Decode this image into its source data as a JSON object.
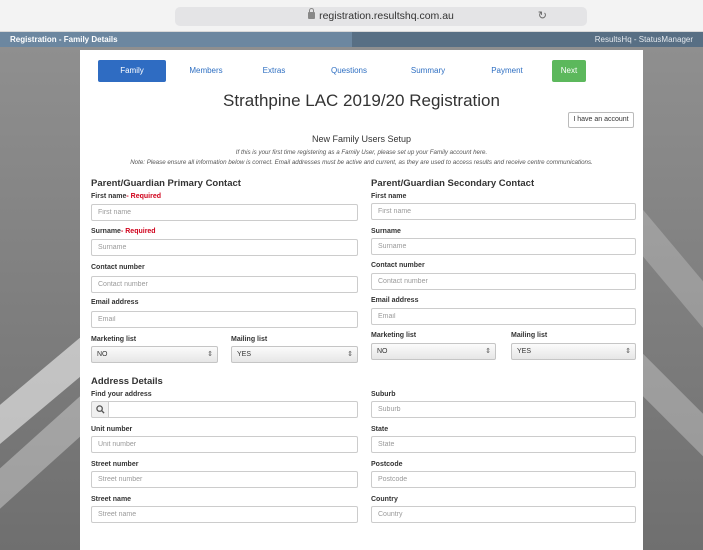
{
  "browser": {
    "url": "registration.resultshq.com.au",
    "tabs": [
      "Registration - Family Details",
      "ResultsHq - StatusManager"
    ]
  },
  "steps": [
    "Family",
    "Members",
    "Extras",
    "Questions",
    "Summary",
    "Payment",
    "Next"
  ],
  "page": {
    "title": "Strathpine LAC 2019/20 Registration",
    "account_button": "I have an account",
    "setup_title": "New Family Users Setup",
    "info_line_1": "If this is your first time registering as a Family User, please set up your Family account here.",
    "info_line_2": "Note: Please ensure all information below is correct. Email addresses must be active and current, as they are used to access results and receive centre communications."
  },
  "primary": {
    "heading": "Parent/Guardian Primary Contact",
    "first_name_label": "First name",
    "required_suffix": "- Required",
    "first_name_placeholder": "First name",
    "surname_label": "Surname",
    "surname_placeholder": "Surname",
    "contact_label": "Contact number",
    "contact_placeholder": "Contact number",
    "email_label": "Email address",
    "email_placeholder": "Email",
    "marketing_label": "Marketing list",
    "marketing_value": "NO",
    "mailing_label": "Mailing list",
    "mailing_value": "YES"
  },
  "secondary": {
    "heading": "Parent/Guardian Secondary Contact",
    "first_name_label": "First name",
    "first_name_placeholder": "First name",
    "surname_label": "Surname",
    "surname_placeholder": "Surname",
    "contact_label": "Contact number",
    "contact_placeholder": "Contact number",
    "email_label": "Email address",
    "email_placeholder": "Email",
    "marketing_label": "Marketing list",
    "marketing_value": "NO",
    "mailing_label": "Mailing list",
    "mailing_value": "YES"
  },
  "address": {
    "heading": "Address Details",
    "find_label": "Find your address",
    "unit_label": "Unit number",
    "unit_placeholder": "Unit number",
    "street_number_label": "Street number",
    "street_number_placeholder": "Street number",
    "street_name_label": "Street name",
    "street_name_placeholder": "Street name",
    "suburb_label": "Suburb",
    "suburb_placeholder": "Suburb",
    "state_label": "State",
    "state_placeholder": "State",
    "postcode_label": "Postcode",
    "postcode_placeholder": "Postcode",
    "country_label": "Country",
    "country_placeholder": "Country"
  },
  "icons": {
    "lock": "lock-icon",
    "reload": "reload-icon",
    "search": "search-icon",
    "select_arrows": "updown-arrow-icon"
  },
  "colors": {
    "primary_blue": "#2f6cc2",
    "next_green": "#5cb85c",
    "required_red": "#d0021b"
  }
}
